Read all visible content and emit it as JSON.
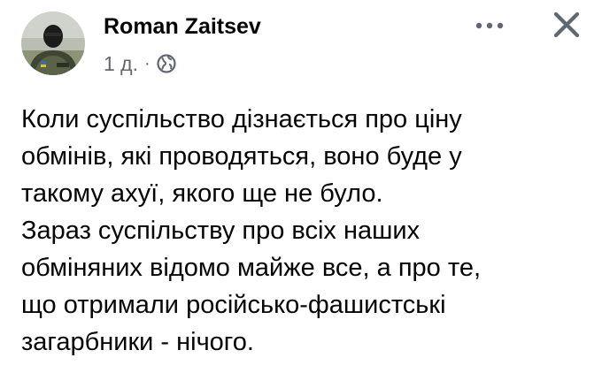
{
  "post": {
    "author": {
      "name": "Roman Zaitsev",
      "avatar_icon": "profile-photo-soldier"
    },
    "timestamp": "1 д.",
    "separator": "·",
    "audience_icon": "globe-icon",
    "more_icon": "more-horizontal-icon",
    "close_icon": "close-icon",
    "text_lines": [
      "Коли суспільство дізнається про ціну",
      "обмінів, які проводяться, воно буде у",
      "такому ахуї, якого ще не було.",
      "Зараз суспільству про всіх наших",
      "обміняних відомо майже все, а про те,",
      "що отримали російсько-фашистські",
      "загарбники - нічого."
    ]
  },
  "colors": {
    "text_primary": "#050505",
    "text_secondary": "#65676b",
    "icon_gray": "#606770",
    "background": "#ffffff"
  }
}
